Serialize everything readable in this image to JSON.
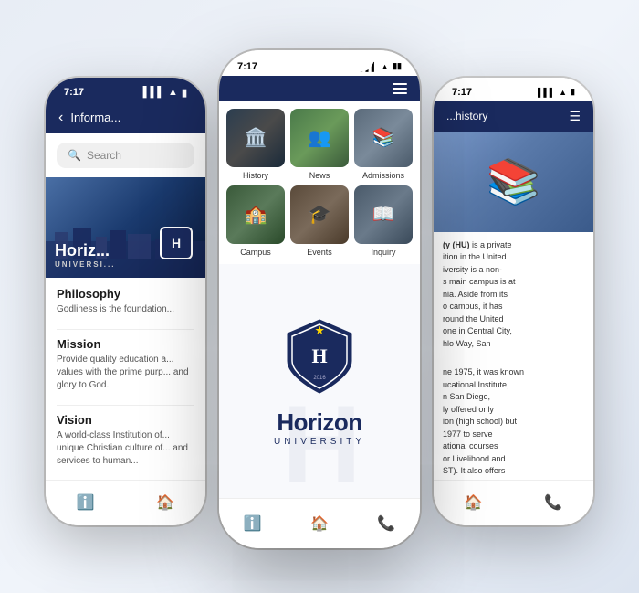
{
  "app": {
    "name": "Horizon University",
    "subtitle": "UNIVERSITY"
  },
  "phones": {
    "left": {
      "time": "7:17",
      "nav_title": "Informa...",
      "search_placeholder": "Search",
      "hero_text": "Horiz...",
      "hero_sub": "UNIVERSI...",
      "badge_text": "H",
      "sections": [
        {
          "title": "Philosophy",
          "text": "Godliness is the foundation..."
        },
        {
          "title": "Mission",
          "text": "Provide quality education a... values with the prime purp... and glory to God."
        },
        {
          "title": "Vision",
          "text": "A world-class Institution of... unique Christian culture of... and services to human..."
        }
      ]
    },
    "center": {
      "time": "7:17",
      "grid_items": [
        {
          "label": "History"
        },
        {
          "label": "News"
        },
        {
          "label": "Admissions"
        },
        {
          "label": "Campus"
        },
        {
          "label": "Events"
        },
        {
          "label": "Inquiry"
        }
      ],
      "splash_title": "Horizon",
      "splash_subtitle": "UNIVERSITY"
    },
    "right": {
      "time": "7:17",
      "nav_title": "...history",
      "content_text": "(y (HU) is a private ition in the United iversity is a non- s main campus is at nia. Aside from its o campus, it has round the United one in Central City, hlo Way, San",
      "content_text2": "ne 1975, it was known ucational Institute, n San Diego, ly offered only ion (high school) but 1977 to serve ational courses or Livelihood and ST). It also offers ames.",
      "is_private_text": "is a private"
    }
  },
  "icons": {
    "back": "‹",
    "menu": "☰",
    "info": "ℹ",
    "home": "⌂",
    "phone": "☎"
  }
}
